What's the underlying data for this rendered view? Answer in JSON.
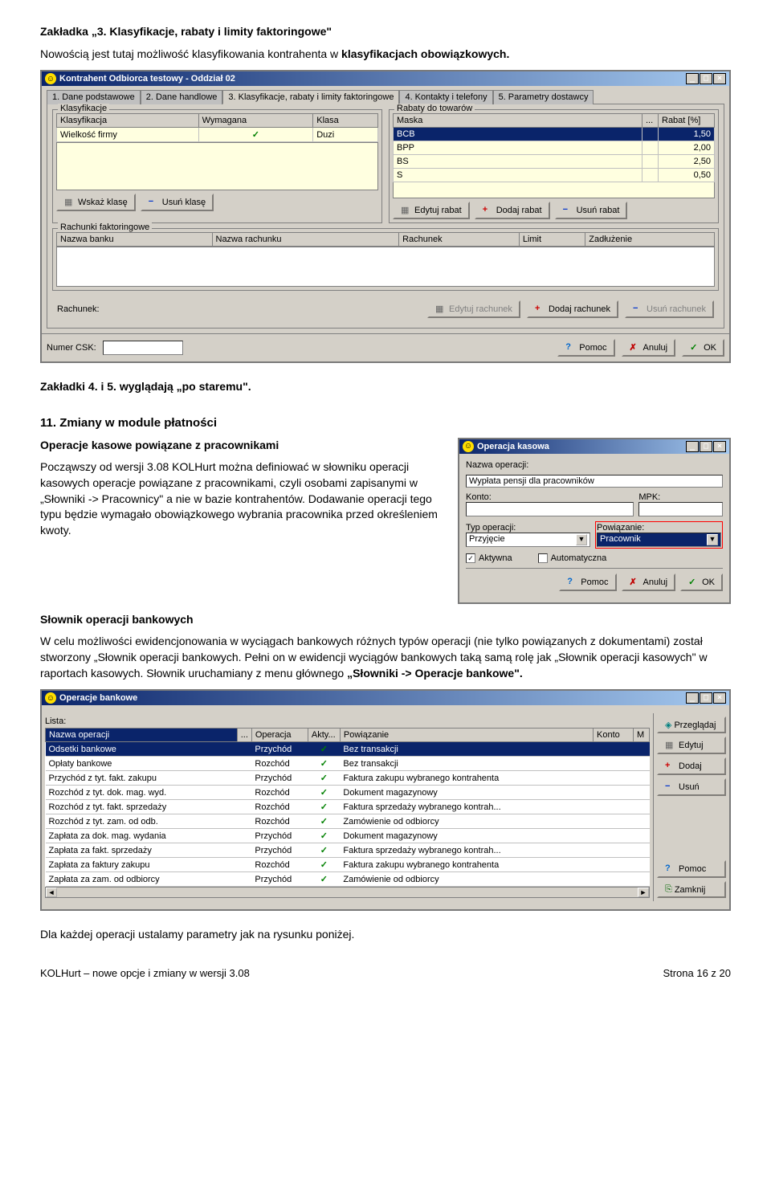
{
  "top": {
    "h1": "Zakładka „3. Klasyfikacje, rabaty i limity faktoringowe\"",
    "p1_a": "Nowością jest tutaj możliwość klasyfikowania kontrahenta w ",
    "p1_b": "klasyfikacjach obowiązkowych."
  },
  "win1": {
    "title": "Kontrahent Odbiorca testowy - Oddział 02",
    "tabs": [
      "1. Dane podstawowe",
      "2. Dane handlowe",
      "3. Klasyfikacje, rabaty i limity faktoringowe",
      "4. Kontakty i telefony",
      "5. Parametry dostawcy"
    ],
    "g_klas": "Klasyfikacje",
    "klas_hdr": [
      "Klasyfikacja",
      "Wymagana",
      "Klasa"
    ],
    "klas_row": [
      "Wielkość firmy",
      "✓",
      "Duzi"
    ],
    "g_rab": "Rabaty do towarów",
    "rab_hdr": [
      "Maska",
      "...",
      "Rabat [%]"
    ],
    "rab_rows": [
      [
        "BCB",
        "",
        "1,50"
      ],
      [
        "BPP",
        "",
        "2,00"
      ],
      [
        "BS",
        "",
        "2,50"
      ],
      [
        "S",
        "",
        "0,50"
      ]
    ],
    "btn_wskaz": "Wskaż klasę",
    "btn_usun_k": "Usuń klasę",
    "btn_edytuj_r": "Edytuj rabat",
    "btn_dodaj_r": "Dodaj rabat",
    "btn_usun_r": "Usuń rabat",
    "g_fakt": "Rachunki faktoringowe",
    "fakt_hdr": [
      "Nazwa banku",
      "Nazwa rachunku",
      "Rachunek",
      "Limit",
      "Zadłużenie"
    ],
    "lbl_rachunek": "Rachunek:",
    "btn_ed_rach": "Edytuj rachunek",
    "btn_dod_rach": "Dodaj rachunek",
    "btn_us_rach": "Usuń rachunek",
    "lbl_csk": "Numer CSK:",
    "btn_pomoc": "Pomoc",
    "btn_anuluj": "Anuluj",
    "btn_ok": "OK"
  },
  "mid": {
    "h2": "Zakładki 4. i 5. wyglądają „po staremu\".",
    "h3": "11. Zmiany w module płatności",
    "sub1": "Operacje kasowe powiązane z pracownikami",
    "p2": "Począwszy od wersji 3.08 KOLHurt można definiować w słowniku operacji kasowych operacje powiązane z pracownikami, czyli osobami zapisanymi w „Słowniki -> Pracownicy\" a nie w bazie kontrahentów. Dodawanie operacji tego typu będzie wymagało obowiązkowego wybrania pracownika przed określeniem kwoty."
  },
  "dlg": {
    "title": "Operacja kasowa",
    "lbl_nazwa": "Nazwa operacji:",
    "val_nazwa": "Wypłata pensji dla pracowników",
    "lbl_konto": "Konto:",
    "lbl_mpk": "MPK:",
    "lbl_typ": "Typ operacji:",
    "val_typ": "Przyjęcie",
    "lbl_pow": "Powiązanie:",
    "val_pow": "Pracownik",
    "cb_akt": "Aktywna",
    "cb_auto": "Automatyczna",
    "btn_pomoc": "Pomoc",
    "btn_anuluj": "Anuluj",
    "btn_ok": "OK"
  },
  "slownik": {
    "h": "Słownik operacji bankowych",
    "p3_a": "W celu możliwości ewidencjonowania w wyciągach bankowych różnych typów operacji (nie tylko powiązanych z dokumentami) został stworzony „Słownik operacji bankowych. Pełni on w ewidencji wyciągów bankowych taką samą rolę jak „Słownik operacji kasowych\" w raportach kasowych. Słownik uruchamiany z menu głównego ",
    "p3_b": "„Słowniki -> Operacje bankowe\"."
  },
  "listwin": {
    "title": "Operacje bankowe",
    "lbl_lista": "Lista:",
    "hdr": [
      "Nazwa operacji",
      "...",
      "Operacja",
      "Akty...",
      "Powiązanie",
      "Konto",
      "M"
    ],
    "rows": [
      [
        "Odsetki bankowe",
        "Przychód",
        "✓",
        "Bez transakcji",
        "",
        ""
      ],
      [
        "Opłaty bankowe",
        "Rozchód",
        "✓",
        "Bez transakcji",
        "",
        ""
      ],
      [
        "Przychód z tyt. fakt. zakupu",
        "Przychód",
        "✓",
        "Faktura zakupu wybranego kontrahenta",
        "",
        ""
      ],
      [
        "Rozchód z tyt. dok. mag. wyd.",
        "Rozchód",
        "✓",
        "Dokument magazynowy",
        "",
        ""
      ],
      [
        "Rozchód z tyt. fakt. sprzedaży",
        "Rozchód",
        "✓",
        "Faktura sprzedaży wybranego kontrah...",
        "",
        ""
      ],
      [
        "Rozchód z tyt. zam. od odb.",
        "Rozchód",
        "✓",
        "Zamówienie od odbiorcy",
        "",
        ""
      ],
      [
        "Zapłata za dok. mag. wydania",
        "Przychód",
        "✓",
        "Dokument magazynowy",
        "",
        ""
      ],
      [
        "Zapłata za fakt. sprzedaży",
        "Przychód",
        "✓",
        "Faktura sprzedaży wybranego kontrah...",
        "",
        ""
      ],
      [
        "Zapłata za faktury zakupu",
        "Rozchód",
        "✓",
        "Faktura zakupu wybranego kontrahenta",
        "",
        ""
      ],
      [
        "Zapłata za zam. od odbiorcy",
        "Przychód",
        "✓",
        "Zamówienie od odbiorcy",
        "",
        ""
      ]
    ],
    "btn_przegladaj": "Przeglądaj",
    "btn_edytuj": "Edytuj",
    "btn_dodaj": "Dodaj",
    "btn_usun": "Usuń",
    "btn_pomoc": "Pomoc",
    "btn_zamknij": "Zamknij"
  },
  "last": "Dla każdej operacji ustalamy parametry jak na rysunku poniżej.",
  "footer": {
    "left": "KOLHurt – nowe opcje i zmiany w wersji 3.08",
    "right": "Strona 16 z 20"
  }
}
